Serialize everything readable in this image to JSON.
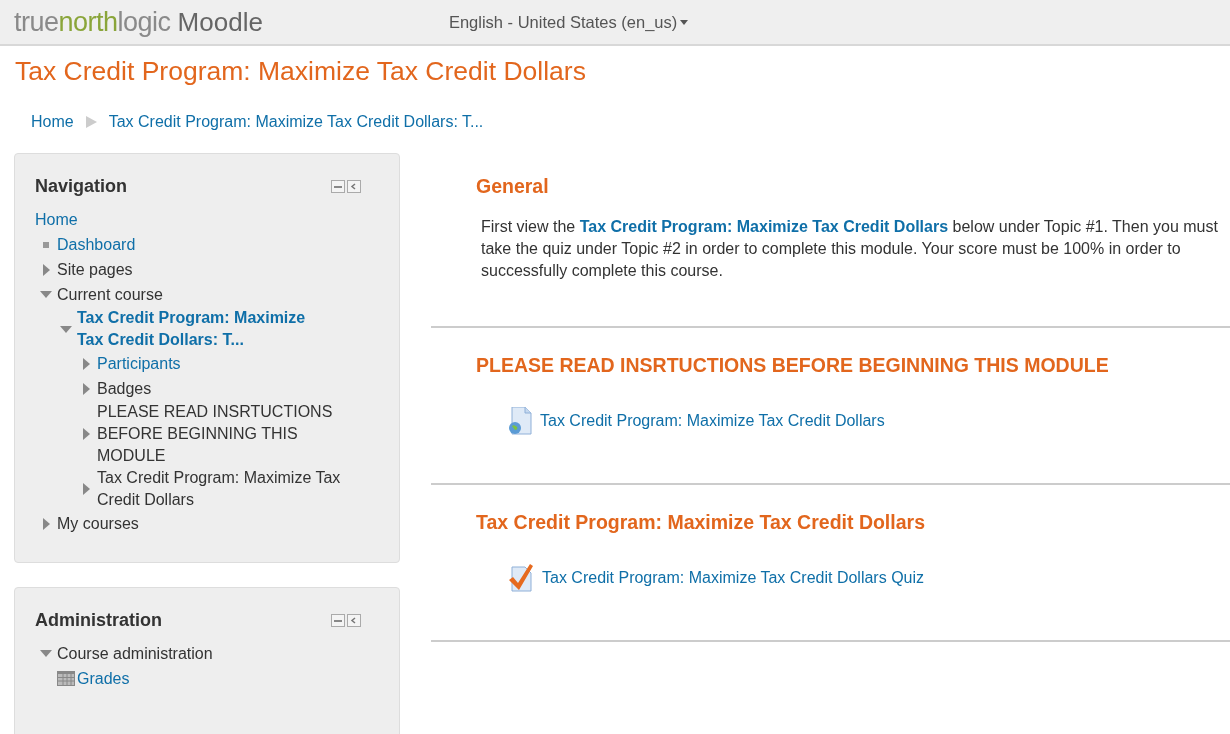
{
  "header": {
    "logo": [
      {
        "text": "true",
        "accent": false
      },
      {
        "text": "north",
        "accent": true
      },
      {
        "text": "logic",
        "accent": false
      }
    ],
    "product": "Moodle",
    "language": "English - United States (en_us)"
  },
  "page_title": "Tax Credit Program: Maximize Tax Credit Dollars",
  "breadcrumb": [
    "Home",
    "Tax Credit Program: Maximize Tax Credit Dollars: T..."
  ],
  "blocks": [
    {
      "title": "Navigation",
      "tree": [
        {
          "label": "Home",
          "kind": "root",
          "link": true
        },
        {
          "label": "Dashboard",
          "kind": "leaf",
          "link": true
        },
        {
          "label": "Site pages",
          "kind": "branch",
          "link": false,
          "expanded": false
        },
        {
          "label": "Current course",
          "kind": "branch",
          "link": false,
          "expanded": true,
          "children": [
            {
              "label": "Tax Credit Program: Maximize Tax Credit Dollars: T...",
              "kind": "course",
              "link": true,
              "expanded": true,
              "children": [
                {
                  "label": "Participants",
                  "kind": "branch",
                  "link": true,
                  "expanded": false
                },
                {
                  "label": "Badges",
                  "kind": "branch",
                  "link": false,
                  "expanded": false
                },
                {
                  "label": "PLEASE READ INSRTUCTIONS BEFORE BEGINNING THIS MODULE",
                  "kind": "branch",
                  "link": false,
                  "expanded": false
                },
                {
                  "label": "Tax Credit Program: Maximize Tax Credit Dollars",
                  "kind": "branch",
                  "link": false,
                  "expanded": false
                }
              ]
            }
          ]
        },
        {
          "label": "My courses",
          "kind": "branch",
          "link": false,
          "expanded": false
        }
      ]
    },
    {
      "title": "Administration",
      "tree": [
        {
          "label": "Course administration",
          "kind": "branch",
          "link": false,
          "expanded": true,
          "children": [
            {
              "label": "Grades",
              "kind": "grades",
              "link": true
            }
          ]
        }
      ]
    }
  ],
  "sections": [
    {
      "title": "General",
      "summary": "First view the **Tax Credit Program: Maximize Tax Credit Dollars**  below under Topic #1. Then you must take the quiz under Topic #2 in order to complete this module. Your score must be 100% in order to successfully complete this course."
    },
    {
      "title": "PLEASE READ INSRTUCTIONS BEFORE BEGINNING THIS MODULE",
      "activities": [
        {
          "kind": "page",
          "label": "Tax Credit Program: Maximize Tax Credit Dollars"
        }
      ]
    },
    {
      "title": "Tax Credit Program: Maximize Tax Credit Dollars",
      "activities": [
        {
          "kind": "quiz",
          "label": "Tax Credit Program: Maximize Tax Credit Dollars Quiz"
        }
      ]
    }
  ]
}
